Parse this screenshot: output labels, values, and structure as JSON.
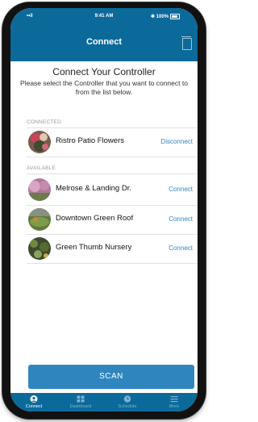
{
  "status": {
    "time": "9:41 AM",
    "battery": "100%"
  },
  "nav": {
    "title": "Connect"
  },
  "intro": {
    "heading": "Connect Your Controller",
    "desc": "Please select the Controller that you want to connect to from the list below."
  },
  "connected": {
    "label": "CONNECTED",
    "items": [
      {
        "name": "Ristro Patio Flowers",
        "action": "Disconnect"
      }
    ]
  },
  "available": {
    "label": "AVAILABLE",
    "items": [
      {
        "name": "Melrose & Landing Dr.",
        "action": "Connect"
      },
      {
        "name": "Downtown Green Roof",
        "action": "Connect"
      },
      {
        "name": "Green Thumb Nursery",
        "action": "Connect"
      }
    ]
  },
  "scan_label": "SCAN",
  "tabs": [
    {
      "label": "Connect",
      "icon": "user-icon"
    },
    {
      "label": "Dashboard",
      "icon": "grid-icon"
    },
    {
      "label": "Schedule",
      "icon": "clock-icon"
    },
    {
      "label": "More",
      "icon": "menu-icon"
    }
  ],
  "colors": {
    "primary": "#0c6a9a",
    "accent": "#2f86bf"
  }
}
